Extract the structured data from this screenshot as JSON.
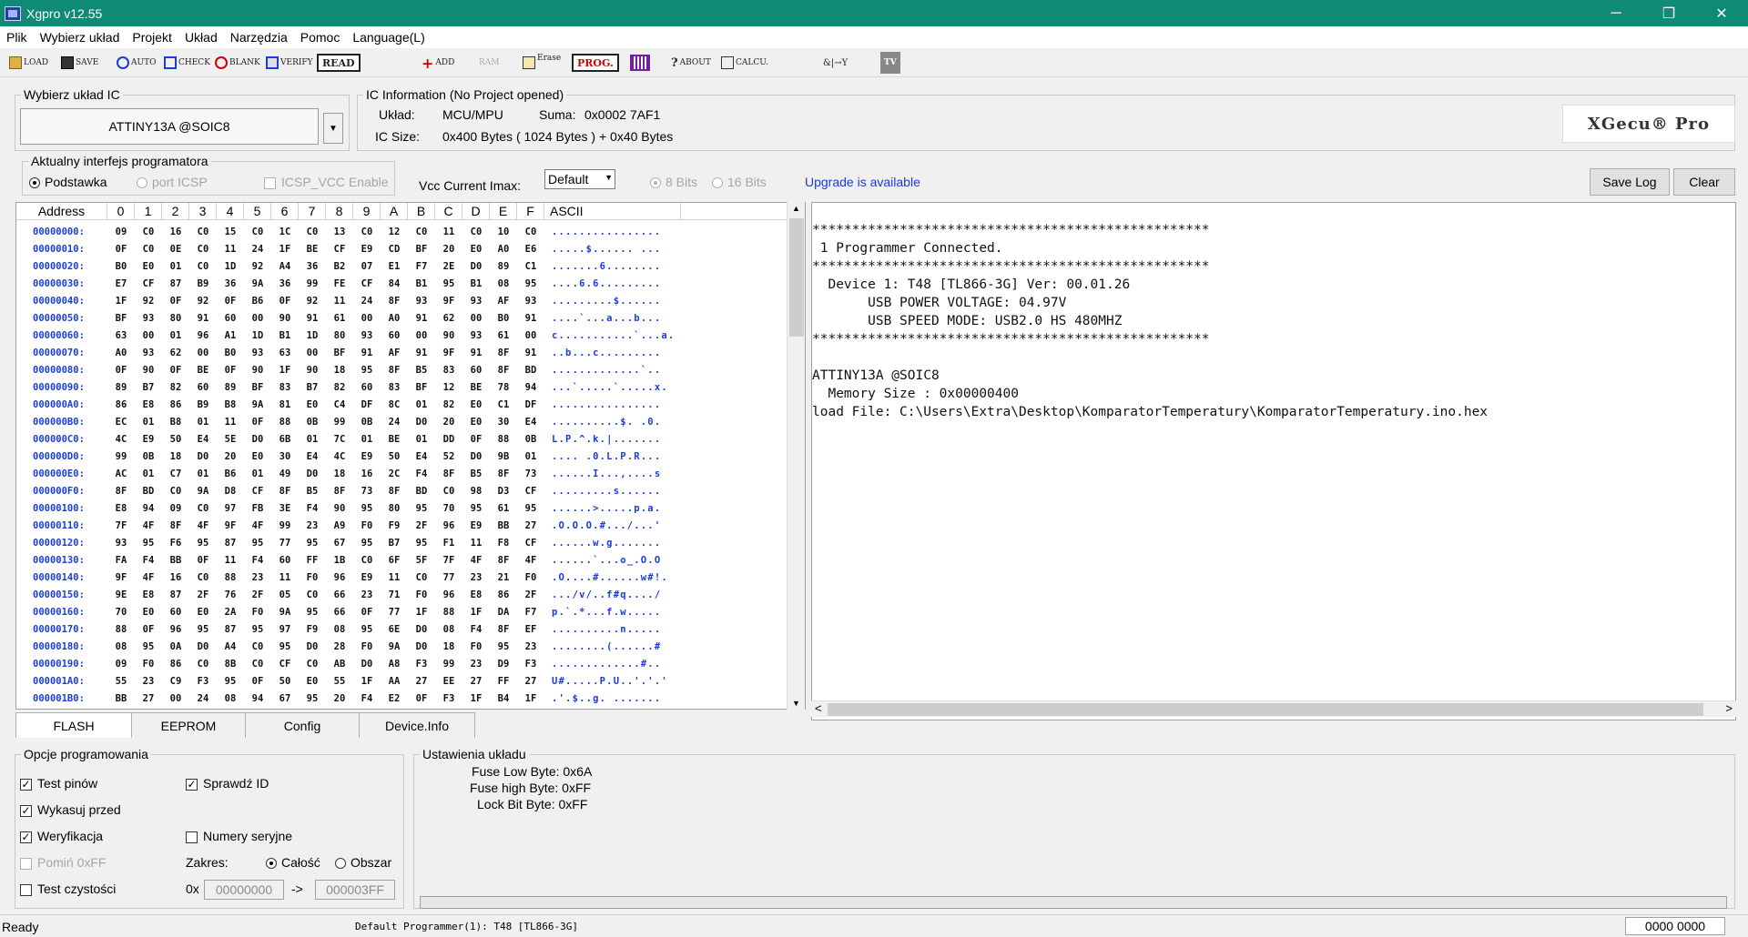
{
  "window": {
    "title": "Xgpro v12.55",
    "min_glyph": "─",
    "max_glyph": "❐",
    "close_glyph": "✕"
  },
  "menu": [
    "Plik",
    "Wybierz układ",
    "Projekt",
    "Układ",
    "Narzędzia",
    "Pomoc",
    "Language(L)"
  ],
  "toolbar": {
    "load": "LOAD",
    "save": "SAVE",
    "auto": "AUTO",
    "check": "CHECK",
    "blank": "BLANK",
    "verify": "VERIFY",
    "read": "READ",
    "add": "ADD",
    "ram": "RAM",
    "erase": "Erase",
    "prog": "PROG.",
    "about": "ABOUT",
    "calcu": "CALCU.",
    "tv": "TV",
    "logic": "&|→Y"
  },
  "chip_group": {
    "title": "Wybierz układ IC",
    "selected": "ATTINY13A @SOIC8"
  },
  "ic_info": {
    "title": "IC Information (No Project opened)",
    "uklad_label": "Układ:",
    "uklad_value": "MCU/MPU",
    "suma_label": "Suma:",
    "suma_value": "0x0002 7AF1",
    "size_label": "IC Size:",
    "size_value": "0x400 Bytes ( 1024 Bytes ) + 0x40 Bytes",
    "brand": "XGecu® Pro"
  },
  "interface": {
    "title": "Aktualny interfejs programatora",
    "podstawka": "Podstawka",
    "port_icsp": "port ICSP",
    "icsp_vcc": "ICSP_VCC Enable",
    "vcc_label": "Vcc Current Imax:",
    "vcc_value": "Default",
    "bits8": "8 Bits",
    "bits16": "16 Bits",
    "upgrade": "Upgrade is available"
  },
  "log_buttons": {
    "save": "Save Log",
    "clear": "Clear"
  },
  "hex": {
    "headers": [
      "Address",
      "0",
      "1",
      "2",
      "3",
      "4",
      "5",
      "6",
      "7",
      "8",
      "9",
      "A",
      "B",
      "C",
      "D",
      "E",
      "F",
      "ASCII"
    ],
    "rows": [
      {
        "addr": "00000000:",
        "bytes": [
          "09",
          "C0",
          "16",
          "C0",
          "15",
          "C0",
          "1C",
          "C0",
          "13",
          "C0",
          "12",
          "C0",
          "11",
          "C0",
          "10",
          "C0"
        ],
        "ascii": "................"
      },
      {
        "addr": "00000010:",
        "bytes": [
          "0F",
          "C0",
          "0E",
          "C0",
          "11",
          "24",
          "1F",
          "BE",
          "CF",
          "E9",
          "CD",
          "BF",
          "20",
          "E0",
          "A0",
          "E6"
        ],
        "ascii": ".....$...... ..."
      },
      {
        "addr": "00000020:",
        "bytes": [
          "B0",
          "E0",
          "01",
          "C0",
          "1D",
          "92",
          "A4",
          "36",
          "B2",
          "07",
          "E1",
          "F7",
          "2E",
          "D0",
          "89",
          "C1"
        ],
        "ascii": ".......6........"
      },
      {
        "addr": "00000030:",
        "bytes": [
          "E7",
          "CF",
          "87",
          "B9",
          "36",
          "9A",
          "36",
          "99",
          "FE",
          "CF",
          "84",
          "B1",
          "95",
          "B1",
          "08",
          "95"
        ],
        "ascii": "....6.6........."
      },
      {
        "addr": "00000040:",
        "bytes": [
          "1F",
          "92",
          "0F",
          "92",
          "0F",
          "B6",
          "0F",
          "92",
          "11",
          "24",
          "8F",
          "93",
          "9F",
          "93",
          "AF",
          "93"
        ],
        "ascii": ".........$......"
      },
      {
        "addr": "00000050:",
        "bytes": [
          "BF",
          "93",
          "80",
          "91",
          "60",
          "00",
          "90",
          "91",
          "61",
          "00",
          "A0",
          "91",
          "62",
          "00",
          "B0",
          "91"
        ],
        "ascii": "....`...a...b..."
      },
      {
        "addr": "00000060:",
        "bytes": [
          "63",
          "00",
          "01",
          "96",
          "A1",
          "1D",
          "B1",
          "1D",
          "80",
          "93",
          "60",
          "00",
          "90",
          "93",
          "61",
          "00"
        ],
        "ascii": "c...........`...a."
      },
      {
        "addr": "00000070:",
        "bytes": [
          "A0",
          "93",
          "62",
          "00",
          "B0",
          "93",
          "63",
          "00",
          "BF",
          "91",
          "AF",
          "91",
          "9F",
          "91",
          "8F",
          "91"
        ],
        "ascii": "..b...c........."
      },
      {
        "addr": "00000080:",
        "bytes": [
          "0F",
          "90",
          "0F",
          "BE",
          "0F",
          "90",
          "1F",
          "90",
          "18",
          "95",
          "8F",
          "B5",
          "83",
          "60",
          "8F",
          "BD"
        ],
        "ascii": ".............`.."
      },
      {
        "addr": "00000090:",
        "bytes": [
          "89",
          "B7",
          "82",
          "60",
          "89",
          "BF",
          "83",
          "B7",
          "82",
          "60",
          "83",
          "BF",
          "12",
          "BE",
          "78",
          "94"
        ],
        "ascii": "...`.....`.....x."
      },
      {
        "addr": "000000A0:",
        "bytes": [
          "86",
          "E8",
          "86",
          "B9",
          "B8",
          "9A",
          "81",
          "E0",
          "C4",
          "DF",
          "8C",
          "01",
          "82",
          "E0",
          "C1",
          "DF"
        ],
        "ascii": "................"
      },
      {
        "addr": "000000B0:",
        "bytes": [
          "EC",
          "01",
          "B8",
          "01",
          "11",
          "0F",
          "88",
          "0B",
          "99",
          "0B",
          "24",
          "D0",
          "20",
          "E0",
          "30",
          "E4"
        ],
        "ascii": "..........$. .0."
      },
      {
        "addr": "000000C0:",
        "bytes": [
          "4C",
          "E9",
          "50",
          "E4",
          "5E",
          "D0",
          "6B",
          "01",
          "7C",
          "01",
          "BE",
          "01",
          "DD",
          "0F",
          "88",
          "0B"
        ],
        "ascii": "L.P.^.k.|......."
      },
      {
        "addr": "000000D0:",
        "bytes": [
          "99",
          "0B",
          "18",
          "D0",
          "20",
          "E0",
          "30",
          "E4",
          "4C",
          "E9",
          "50",
          "E4",
          "52",
          "D0",
          "9B",
          "01"
        ],
        "ascii": ".... .0.L.P.R..."
      },
      {
        "addr": "000000E0:",
        "bytes": [
          "AC",
          "01",
          "C7",
          "01",
          "B6",
          "01",
          "49",
          "D0",
          "18",
          "16",
          "2C",
          "F4",
          "8F",
          "B5",
          "8F",
          "73"
        ],
        "ascii": "......I...,....s"
      },
      {
        "addr": "000000F0:",
        "bytes": [
          "8F",
          "BD",
          "C0",
          "9A",
          "D8",
          "CF",
          "8F",
          "B5",
          "8F",
          "73",
          "8F",
          "BD",
          "C0",
          "98",
          "D3",
          "CF"
        ],
        "ascii": ".........s......"
      },
      {
        "addr": "00000100:",
        "bytes": [
          "E8",
          "94",
          "09",
          "C0",
          "97",
          "FB",
          "3E",
          "F4",
          "90",
          "95",
          "80",
          "95",
          "70",
          "95",
          "61",
          "95"
        ],
        "ascii": "......>.....p.a."
      },
      {
        "addr": "00000110:",
        "bytes": [
          "7F",
          "4F",
          "8F",
          "4F",
          "9F",
          "4F",
          "99",
          "23",
          "A9",
          "F0",
          "F9",
          "2F",
          "96",
          "E9",
          "BB",
          "27"
        ],
        "ascii": ".O.O.O.#.../...'"
      },
      {
        "addr": "00000120:",
        "bytes": [
          "93",
          "95",
          "F6",
          "95",
          "87",
          "95",
          "77",
          "95",
          "67",
          "95",
          "B7",
          "95",
          "F1",
          "11",
          "F8",
          "CF"
        ],
        "ascii": "......w.g......."
      },
      {
        "addr": "00000130:",
        "bytes": [
          "FA",
          "F4",
          "BB",
          "0F",
          "11",
          "F4",
          "60",
          "FF",
          "1B",
          "C0",
          "6F",
          "5F",
          "7F",
          "4F",
          "8F",
          "4F"
        ],
        "ascii": "......`...o_.O.O"
      },
      {
        "addr": "00000140:",
        "bytes": [
          "9F",
          "4F",
          "16",
          "C0",
          "88",
          "23",
          "11",
          "F0",
          "96",
          "E9",
          "11",
          "C0",
          "77",
          "23",
          "21",
          "F0"
        ],
        "ascii": ".O....#......w#!."
      },
      {
        "addr": "00000150:",
        "bytes": [
          "9E",
          "E8",
          "87",
          "2F",
          "76",
          "2F",
          "05",
          "C0",
          "66",
          "23",
          "71",
          "F0",
          "96",
          "E8",
          "86",
          "2F"
        ],
        "ascii": ".../v/..f#q..../"
      },
      {
        "addr": "00000160:",
        "bytes": [
          "70",
          "E0",
          "60",
          "E0",
          "2A",
          "F0",
          "9A",
          "95",
          "66",
          "0F",
          "77",
          "1F",
          "88",
          "1F",
          "DA",
          "F7"
        ],
        "ascii": "p.`.*...f.w....."
      },
      {
        "addr": "00000170:",
        "bytes": [
          "88",
          "0F",
          "96",
          "95",
          "87",
          "95",
          "97",
          "F9",
          "08",
          "95",
          "6E",
          "D0",
          "08",
          "F4",
          "8F",
          "EF"
        ],
        "ascii": "..........n....."
      },
      {
        "addr": "00000180:",
        "bytes": [
          "08",
          "95",
          "0A",
          "D0",
          "A4",
          "C0",
          "95",
          "D0",
          "28",
          "F0",
          "9A",
          "D0",
          "18",
          "F0",
          "95",
          "23"
        ],
        "ascii": "........(......#"
      },
      {
        "addr": "00000190:",
        "bytes": [
          "09",
          "F0",
          "86",
          "C0",
          "8B",
          "C0",
          "CF",
          "C0",
          "AB",
          "D0",
          "A8",
          "F3",
          "99",
          "23",
          "D9",
          "F3"
        ],
        "ascii": ".............#.."
      },
      {
        "addr": "000001A0:",
        "bytes": [
          "55",
          "23",
          "C9",
          "F3",
          "95",
          "0F",
          "50",
          "E0",
          "55",
          "1F",
          "AA",
          "27",
          "EE",
          "27",
          "FF",
          "27"
        ],
        "ascii": "U#.....P.U..'.'.'"
      },
      {
        "addr": "000001B0:",
        "bytes": [
          "BB",
          "27",
          "00",
          "24",
          "08",
          "94",
          "67",
          "95",
          "20",
          "F4",
          "E2",
          "0F",
          "F3",
          "1F",
          "B4",
          "1F"
        ],
        "ascii": ".'.$..g. ......."
      }
    ]
  },
  "log_lines": [
    "**************************************************",
    " 1 Programmer Connected.",
    "**************************************************",
    "  Device 1: T48 [TL866-3G] Ver: 00.01.26",
    "       USB POWER VOLTAGE: 04.97V",
    "       USB SPEED MODE: USB2.0 HS 480MHZ",
    "**************************************************",
    "",
    "ATTINY13A @SOIC8",
    "  Memory Size : 0x00000400",
    "load File: C:\\Users\\Extra\\Desktop\\KomparatorTemperatury\\KomparatorTemperatury.ino.hex"
  ],
  "tabs": [
    "FLASH",
    "EEPROM",
    "Config",
    "Device.Info"
  ],
  "options": {
    "title": "Opcje programowania",
    "test_pinow": "Test pinów",
    "sprawdz_id": "Sprawdź ID",
    "wykasuj": "Wykasuj przed",
    "weryfikacja": "Weryfikacja",
    "numery": "Numery seryjne",
    "pomin": "Pomiń 0xFF",
    "zakres": "Zakres:",
    "calosc": "Całość",
    "obszar": "Obszar",
    "test_czystosci": "Test czystości",
    "ox": "0x",
    "from": "00000000",
    "arrow": "->",
    "to": "000003FF",
    "check_mark": "✓"
  },
  "settings": {
    "title": "Ustawienia układu",
    "fuse_low": "Fuse Low Byte: 0x6A",
    "fuse_high": "Fuse high Byte: 0xFF",
    "lock": "Lock Bit Byte: 0xFF"
  },
  "status": {
    "ready": "Ready",
    "programmer": "Default Programmer(1): T48 [TL866-3G]",
    "counter": "0000 0000"
  },
  "scroll_glyphs": {
    "up": "▲",
    "down": "▼",
    "left": "<",
    "right": ">",
    "drop": "▼"
  }
}
